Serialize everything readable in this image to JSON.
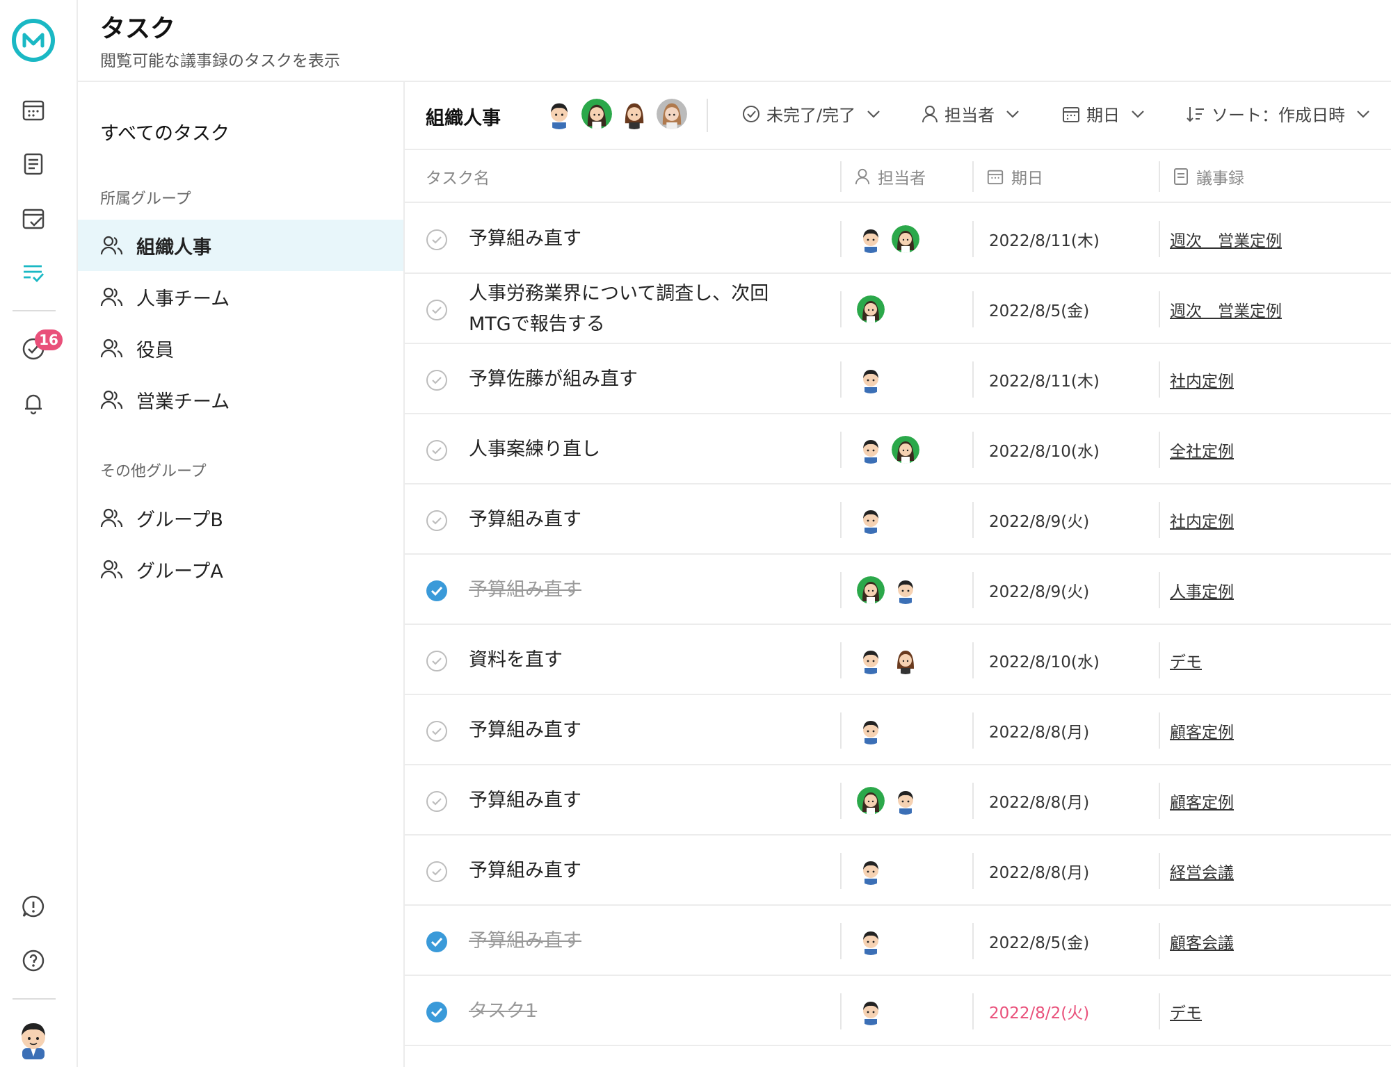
{
  "header": {
    "title": "タスク",
    "subtitle": "閲覧可能な議事録のタスクを表示"
  },
  "rail": {
    "badge_count": "16"
  },
  "groups": {
    "all_tasks": "すべてのタスク",
    "own_section": "所属グループ",
    "own": [
      "組織人事",
      "人事チーム",
      "役員",
      "営業チーム"
    ],
    "other_section": "その他グループ",
    "other": [
      "グループB",
      "グループA"
    ]
  },
  "toolbar": {
    "group_name": "組織人事",
    "filter_status": "未完了/完了",
    "filter_assignee": "担当者",
    "filter_due": "期日",
    "sort": "ソート：作成日時"
  },
  "table": {
    "headers": {
      "name": "タスク名",
      "assignee": "担当者",
      "due": "期日",
      "minutes": "議事録"
    },
    "rows": [
      {
        "name": "予算組み直す",
        "done": false,
        "assignees": [
          "man",
          "woman-green"
        ],
        "due": "2022/8/11(木)",
        "minutes": "週次　営業定例",
        "overdue": false
      },
      {
        "name": "人事労務業界について調査し、次回MTGで報告する",
        "done": false,
        "assignees": [
          "woman-green"
        ],
        "due": "2022/8/5(金)",
        "minutes": "週次　営業定例",
        "overdue": false
      },
      {
        "name": "予算佐藤が組み直す",
        "done": false,
        "assignees": [
          "man"
        ],
        "due": "2022/8/11(木)",
        "minutes": "社内定例",
        "overdue": false
      },
      {
        "name": "人事案練り直し",
        "done": false,
        "assignees": [
          "man",
          "woman-green"
        ],
        "due": "2022/8/10(水)",
        "minutes": "全社定例",
        "overdue": false
      },
      {
        "name": "予算組み直す",
        "done": false,
        "assignees": [
          "man"
        ],
        "due": "2022/8/9(火)",
        "minutes": "社内定例",
        "overdue": false
      },
      {
        "name": "予算組み直す",
        "done": true,
        "assignees": [
          "woman-green",
          "man"
        ],
        "due": "2022/8/9(火)",
        "minutes": "人事定例",
        "overdue": false
      },
      {
        "name": "資料を直す",
        "done": false,
        "assignees": [
          "man",
          "woman-brown"
        ],
        "due": "2022/8/10(水)",
        "minutes": "デモ",
        "overdue": false
      },
      {
        "name": "予算組み直す",
        "done": false,
        "assignees": [
          "man"
        ],
        "due": "2022/8/8(月)",
        "minutes": "顧客定例",
        "overdue": false
      },
      {
        "name": "予算組み直す",
        "done": false,
        "assignees": [
          "woman-green",
          "man"
        ],
        "due": "2022/8/8(月)",
        "minutes": "顧客定例",
        "overdue": false
      },
      {
        "name": "予算組み直す",
        "done": false,
        "assignees": [
          "man"
        ],
        "due": "2022/8/8(月)",
        "minutes": "経営会議",
        "overdue": false
      },
      {
        "name": "予算組み直す",
        "done": true,
        "assignees": [
          "man"
        ],
        "due": "2022/8/5(金)",
        "minutes": "顧客会議",
        "overdue": false
      },
      {
        "name": "タスク1",
        "done": true,
        "assignees": [
          "man"
        ],
        "due": "2022/8/2(火)",
        "minutes": "デモ",
        "overdue": true
      }
    ]
  },
  "colors": {
    "accent": "#1ab8c4",
    "check_done": "#3a9ad9",
    "overdue": "#e9507a",
    "badge": "#e9507a",
    "active_group_bg": "#e8f6fa"
  }
}
